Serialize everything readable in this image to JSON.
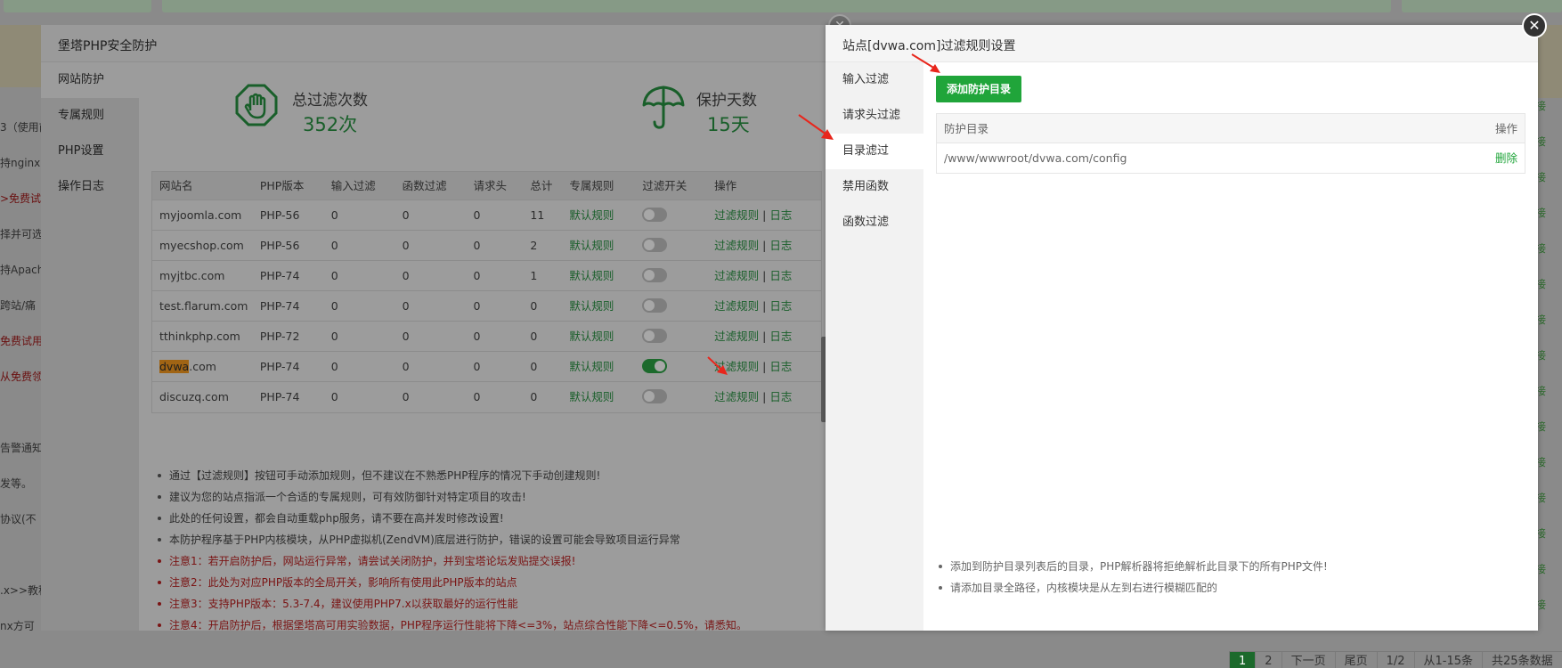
{
  "background": {
    "left_snippets": [
      "3（使用前",
      "持nginx",
      ">免费试用",
      "择并可选",
      "持Apach",
      "跨站/痛",
      "免费试用",
      "从免费领取",
      "告警通知",
      "发等。",
      "协议(不",
      ".x>>教程",
      "nx方可"
    ],
    "right_snippets": [
      "接",
      "接",
      "接",
      "接",
      "接",
      "接",
      "接",
      "接",
      "接",
      "接",
      "接",
      "接",
      "接",
      "接",
      "接"
    ],
    "pagination": [
      "1",
      "2",
      "下一页",
      "尾页",
      "1/2",
      "从1-15条",
      "共25条数据"
    ]
  },
  "left_dialog": {
    "title": "堡塔PHP安全防护",
    "nav": [
      "网站防护",
      "专属规则",
      "PHP设置",
      "操作日志"
    ],
    "stats": [
      {
        "label": "总过滤次数",
        "value": "352次",
        "icon": "hand-shield-icon"
      },
      {
        "label": "保护天数",
        "value": "15天",
        "icon": "umbrella-icon"
      }
    ],
    "table": {
      "headers": [
        "网站名",
        "PHP版本",
        "输入过滤",
        "函数过滤",
        "请求头",
        "总计",
        "专属规则",
        "过滤开关",
        "操作"
      ],
      "rows": [
        {
          "site": "myjoomla.com",
          "php": "PHP-56",
          "input": "0",
          "func": "0",
          "header": "0",
          "total": "11",
          "rule": "默认规则",
          "on": false
        },
        {
          "site": "myecshop.com",
          "php": "PHP-56",
          "input": "0",
          "func": "0",
          "header": "0",
          "total": "2",
          "rule": "默认规则",
          "on": false
        },
        {
          "site": "myjtbc.com",
          "php": "PHP-74",
          "input": "0",
          "func": "0",
          "header": "0",
          "total": "1",
          "rule": "默认规则",
          "on": false
        },
        {
          "site": "test.flarum.com",
          "php": "PHP-74",
          "input": "0",
          "func": "0",
          "header": "0",
          "total": "0",
          "rule": "默认规则",
          "on": false
        },
        {
          "site": "tthinkphp.com",
          "php": "PHP-72",
          "input": "0",
          "func": "0",
          "header": "0",
          "total": "0",
          "rule": "默认规则",
          "on": false
        },
        {
          "site_hl": "dvwa",
          "site_rest": ".com",
          "php": "PHP-74",
          "input": "0",
          "func": "0",
          "header": "0",
          "total": "0",
          "rule": "默认规则",
          "on": true
        },
        {
          "site": "discuzq.com",
          "php": "PHP-74",
          "input": "0",
          "func": "0",
          "header": "0",
          "total": "0",
          "rule": "默认规则",
          "on": false
        }
      ],
      "action_filter": "过滤规则",
      "action_sep": "|",
      "action_log": "日志"
    },
    "notes": [
      {
        "text": "通过【过滤规则】按钮可手动添加规则，但不建议在不熟悉PHP程序的情况下手动创建规则!",
        "red": false
      },
      {
        "text": "建议为您的站点指派一个合适的专属规则，可有效防御针对特定项目的攻击!",
        "red": false
      },
      {
        "text": "此处的任何设置，都会自动重载php服务，请不要在高并发时修改设置!",
        "red": false
      },
      {
        "text": "本防护程序基于PHP内核模块，从PHP虚拟机(ZendVM)底层进行防护，错误的设置可能会导致项目运行异常",
        "red": false
      },
      {
        "text": "注意1：若开启防护后，网站运行异常，请尝试关闭防护，并到宝塔论坛发贴提交误报!",
        "red": true
      },
      {
        "text": "注意2：此处为对应PHP版本的全局开关，影响所有使用此PHP版本的站点",
        "red": true
      },
      {
        "text": "注意3：支持PHP版本：5.3-7.4，建议使用PHP7.x以获取最好的运行性能",
        "red": true
      },
      {
        "text": "注意4：开启防护后，根据堡塔高可用实验数据，PHP程序运行性能将下降<=3%，站点综合性能下降<=0.5%，请悉知。",
        "red": true
      }
    ]
  },
  "right_dialog": {
    "title": "站点[dvwa.com]过滤规则设置",
    "nav": [
      "输入过滤",
      "请求头过滤",
      "目录滤过",
      "禁用函数",
      "函数过滤"
    ],
    "add_button": "添加防护目录",
    "table_headers": {
      "dir": "防护目录",
      "op": "操作"
    },
    "rows": [
      {
        "path": "/www/wwwroot/dvwa.com/config",
        "action": "删除"
      }
    ],
    "notes": [
      "添加到防护目录列表后的目录，PHP解析器将拒绝解析此目录下的所有PHP文件!",
      "请添加目录全路径，内核模块是从左到右进行模糊匹配的"
    ]
  },
  "colors": {
    "brand_green": "#20a53a",
    "arrow_red": "#e8261c"
  }
}
